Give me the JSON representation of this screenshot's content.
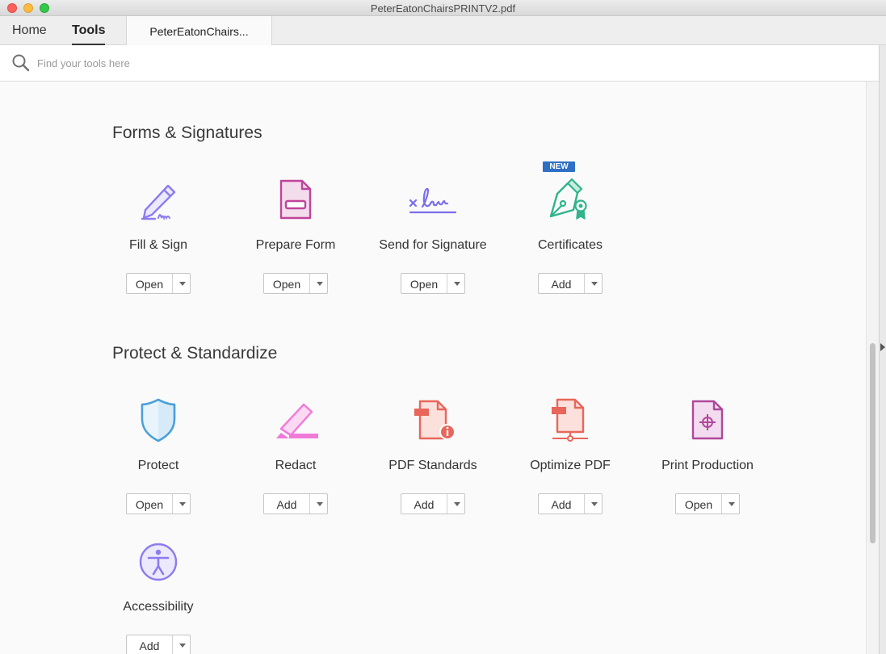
{
  "window": {
    "title": "PeterEatonChairsPRINTV2.pdf"
  },
  "tabs": {
    "home": "Home",
    "tools": "Tools",
    "document": "PeterEatonChairs..."
  },
  "search": {
    "placeholder": "Find your tools here",
    "value": ""
  },
  "sections": [
    {
      "title": "Forms & Signatures",
      "tools": [
        {
          "label": "Fill & Sign",
          "button": "Open",
          "icon": "fill-sign-icon",
          "color": "#8b7cf0"
        },
        {
          "label": "Prepare Form",
          "button": "Open",
          "icon": "prepare-form-icon",
          "color": "#c0449a"
        },
        {
          "label": "Send for Signature",
          "button": "Open",
          "icon": "send-signature-icon",
          "color": "#7b6ee8"
        },
        {
          "label": "Certificates",
          "button": "Add",
          "icon": "certificates-icon",
          "color": "#2fb48c",
          "badge": "NEW"
        }
      ]
    },
    {
      "title": "Protect & Standardize",
      "tools": [
        {
          "label": "Protect",
          "button": "Open",
          "icon": "shield-icon",
          "color": "#4a9fd8"
        },
        {
          "label": "Redact",
          "button": "Add",
          "icon": "redact-icon",
          "color": "#f07ad8"
        },
        {
          "label": "PDF Standards",
          "button": "Add",
          "icon": "pdf-standards-icon",
          "color": "#e8665a"
        },
        {
          "label": "Optimize PDF",
          "button": "Add",
          "icon": "optimize-pdf-icon",
          "color": "#e8665a"
        },
        {
          "label": "Print Production",
          "button": "Open",
          "icon": "print-production-icon",
          "color": "#b0479c"
        },
        {
          "label": "Accessibility",
          "button": "Add",
          "icon": "accessibility-icon",
          "color": "#8b7cf0"
        }
      ]
    }
  ]
}
